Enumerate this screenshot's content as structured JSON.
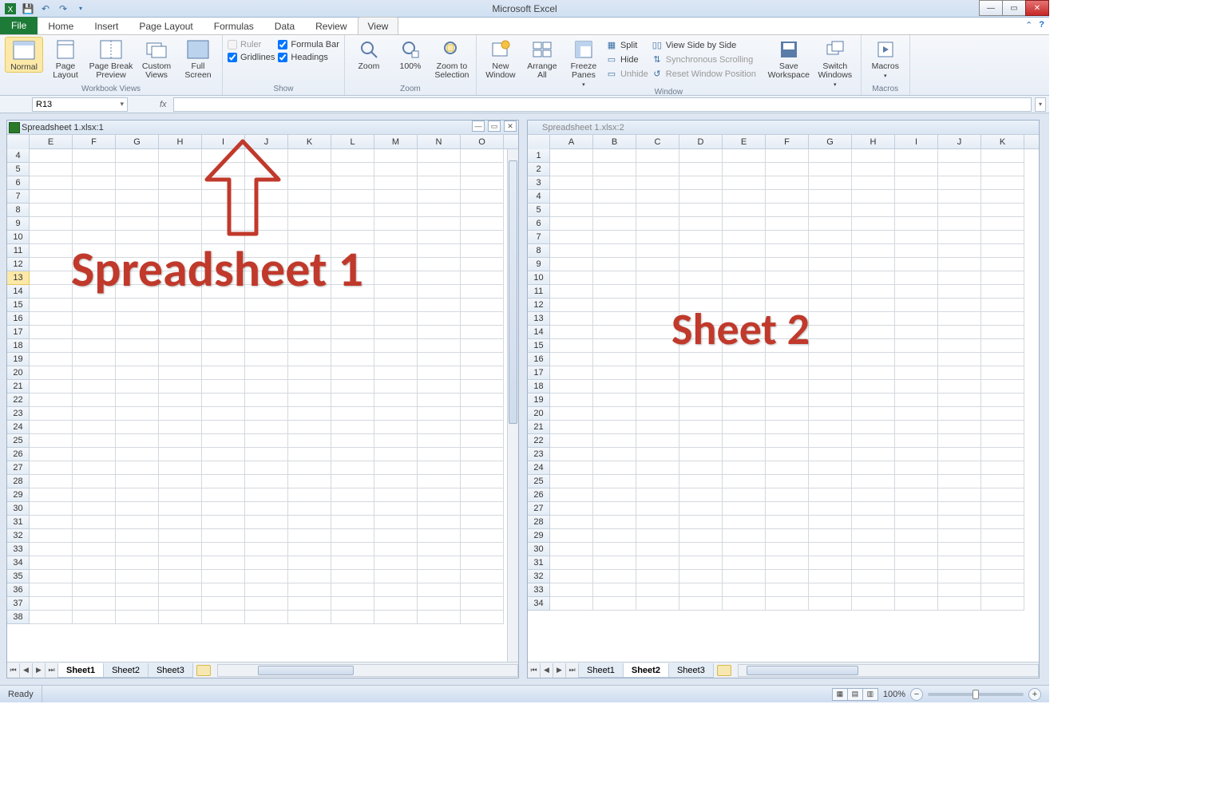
{
  "app_title": "Microsoft Excel",
  "tabs": {
    "file": "File",
    "items": [
      "Home",
      "Insert",
      "Page Layout",
      "Formulas",
      "Data",
      "Review",
      "View"
    ],
    "active": "View"
  },
  "ribbon": {
    "workbook_views": {
      "label": "Workbook Views",
      "normal": "Normal",
      "page_layout": "Page\nLayout",
      "page_break": "Page Break\nPreview",
      "custom_views": "Custom\nViews",
      "full_screen": "Full\nScreen"
    },
    "show": {
      "label": "Show",
      "ruler": "Ruler",
      "gridlines": "Gridlines",
      "formula_bar": "Formula Bar",
      "headings": "Headings"
    },
    "zoom": {
      "label": "Zoom",
      "zoom": "Zoom",
      "hundred": "100%",
      "to_selection": "Zoom to\nSelection"
    },
    "window": {
      "label": "Window",
      "new_window": "New\nWindow",
      "arrange_all": "Arrange\nAll",
      "freeze_panes": "Freeze\nPanes",
      "split": "Split",
      "hide": "Hide",
      "unhide": "Unhide",
      "side_by_side": "View Side by Side",
      "sync_scroll": "Synchronous Scrolling",
      "reset_pos": "Reset Window Position",
      "save_workspace": "Save\nWorkspace",
      "switch_windows": "Switch\nWindows"
    },
    "macros": {
      "label": "Macros",
      "macros": "Macros"
    }
  },
  "formula_bar": {
    "name_box": "R13",
    "fx": "fx"
  },
  "left_window": {
    "title": "Spreadsheet 1.xlsx:1",
    "cols": [
      "E",
      "F",
      "G",
      "H",
      "I",
      "J",
      "K",
      "L",
      "M",
      "N",
      "O"
    ],
    "row_start": 4,
    "row_end": 38,
    "selected_row": 13,
    "sheets": [
      "Sheet1",
      "Sheet2",
      "Sheet3"
    ],
    "active_sheet": "Sheet1",
    "annotation": "Spreadsheet 1"
  },
  "right_window": {
    "title": "Spreadsheet 1.xlsx:2",
    "cols": [
      "A",
      "B",
      "C",
      "D",
      "E",
      "F",
      "G",
      "H",
      "I",
      "J",
      "K"
    ],
    "row_start": 1,
    "row_end": 34,
    "sheets": [
      "Sheet1",
      "Sheet2",
      "Sheet3"
    ],
    "active_sheet": "Sheet2",
    "annotation": "Sheet 2"
  },
  "status": {
    "ready": "Ready",
    "zoom": "100%"
  },
  "colors": {
    "annotation": "#c0392b"
  }
}
